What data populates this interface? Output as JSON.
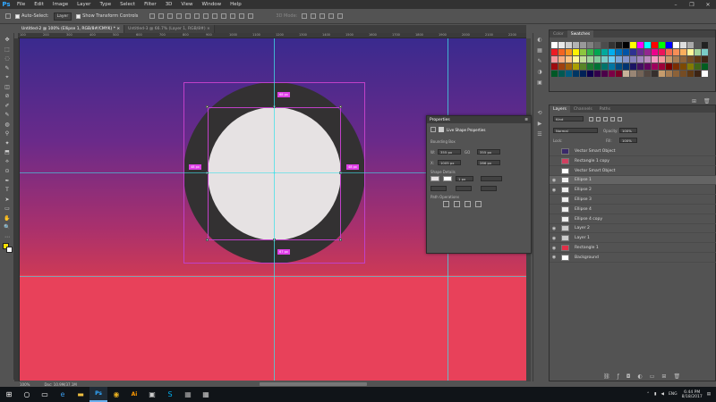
{
  "app": {
    "logo": "Ps"
  },
  "menu": [
    "File",
    "Edit",
    "Image",
    "Layer",
    "Type",
    "Select",
    "Filter",
    "3D",
    "View",
    "Window",
    "Help"
  ],
  "window_controls": {
    "minimize": "–",
    "restore": "❐",
    "close": "✕"
  },
  "options": {
    "auto_select_label": "Auto-Select:",
    "auto_select_value": "Layer",
    "transform_label": "Show Transform Controls",
    "mode_3d": "3D Mode:"
  },
  "tabs": [
    {
      "label": "Untitled-2 @ 100% (Ellipse 1, RGB/8#/CMYK) *  ×"
    },
    {
      "label": "Untitled-3 @ 66.7% (Layer 1, RGB/8#) ×"
    }
  ],
  "ruler": {
    "h": [
      "100",
      "200",
      "300",
      "400",
      "500",
      "600",
      "700",
      "800",
      "900",
      "1000",
      "1100",
      "1200",
      "1300",
      "1400",
      "1500",
      "1600",
      "1700",
      "1800",
      "1900",
      "2000",
      "2100",
      "2200"
    ]
  },
  "tools": [
    "✥",
    "⬚",
    "◌",
    "✎",
    "⌖",
    "◫",
    "⊘",
    "✐",
    "✎",
    "◍",
    "⚲",
    "✦",
    "⬒",
    "⟡",
    "⊙",
    "✒",
    "T",
    "➤",
    "▭",
    "✋",
    "🔍",
    "⋯"
  ],
  "measure": {
    "top": "68 px",
    "left": "48 px",
    "right": "48 px",
    "bottom": "67 px"
  },
  "status": {
    "zoom": "100%",
    "doc": "Doc: 10.9M/37.1M"
  },
  "swatches_panel": {
    "tabs": [
      "Color",
      "Swatches"
    ],
    "colors": [
      "#ffffff",
      "#e9e9e9",
      "#cfcfcf",
      "#b3b3b3",
      "#999999",
      "#808080",
      "#666666",
      "#4c4c4c",
      "#333333",
      "#1a1a1a",
      "#000000",
      "#ffff00",
      "#ff00ff",
      "#00ffff",
      "#ff0000",
      "#00ff00",
      "#0000ff",
      "#ffffff",
      "#dddddd",
      "#aaaaaa",
      "#555555",
      "#222222",
      "#ed1c24",
      "#f26522",
      "#f7941d",
      "#fff200",
      "#8dc63f",
      "#39b54a",
      "#00a651",
      "#00a99d",
      "#00aeef",
      "#0072bc",
      "#0054a6",
      "#2e3192",
      "#662d91",
      "#92278f",
      "#ec008c",
      "#ed145b",
      "#f26c4f",
      "#f68e56",
      "#fbaf5d",
      "#fff799",
      "#a3d39c",
      "#7accc8",
      "#f5989d",
      "#f9ad81",
      "#fdc68a",
      "#fff799",
      "#c4df9b",
      "#a3d39c",
      "#82ca9c",
      "#7accc8",
      "#6dcff6",
      "#7da7d9",
      "#8393ca",
      "#8781bd",
      "#a187be",
      "#bc8dbf",
      "#f49ac2",
      "#f6989d",
      "#c69c6d",
      "#a67c52",
      "#8c6239",
      "#754c24",
      "#603913",
      "#3c2415",
      "#9e0b0f",
      "#a0410d",
      "#a36209",
      "#aba000",
      "#598527",
      "#1a7b30",
      "#007236",
      "#00746b",
      "#0076a3",
      "#004b80",
      "#003471",
      "#1b1464",
      "#440e62",
      "#630460",
      "#9e005d",
      "#9e0039",
      "#790000",
      "#7b2e00",
      "#7d4900",
      "#827b00",
      "#406618",
      "#005e20",
      "#005826",
      "#005952",
      "#005b7f",
      "#003663",
      "#002157",
      "#0d004c",
      "#32004b",
      "#4b0049",
      "#7b0046",
      "#7a0026",
      "#c7b299",
      "#998675",
      "#736357",
      "#534741",
      "#362f2d",
      "#c69c6d",
      "#a67c52",
      "#8c6239",
      "#754c24",
      "#603913",
      "#3c2415",
      "#ffffff"
    ]
  },
  "layers_panel": {
    "tabs": [
      "Layers",
      "Channels",
      "Paths"
    ],
    "kind": "Kind",
    "blend": "Normal",
    "opacity_label": "Opacity:",
    "opacity": "100%",
    "lock_label": "Lock:",
    "fill_label": "Fill:",
    "fill": "100%",
    "layers": [
      {
        "name": "Vector Smart Object",
        "eye": "",
        "thumb": "#3a2a6a"
      },
      {
        "name": "Rectangle 1 copy",
        "eye": "",
        "thumb": "#d04060"
      },
      {
        "name": "Vector Smart Object",
        "eye": "",
        "thumb": "#ffffff"
      },
      {
        "name": "Ellipse 1",
        "eye": "◉",
        "thumb": "#f0f0f0",
        "selected": true
      },
      {
        "name": "Ellipse 2",
        "eye": "◉",
        "thumb": "#eeeeee"
      },
      {
        "name": "Ellipse 3",
        "eye": "",
        "thumb": "#eeeeee"
      },
      {
        "name": "Ellipse 4",
        "eye": "",
        "thumb": "#eeeeee"
      },
      {
        "name": "Ellipse 4 copy",
        "eye": "",
        "thumb": "#eeeeee"
      },
      {
        "name": "Layer 2",
        "eye": "◉",
        "thumb": "#cccccc"
      },
      {
        "name": "Layer 1",
        "eye": "◉",
        "thumb": "#cccccc"
      },
      {
        "name": "Rectangle 1",
        "eye": "◉",
        "thumb": "#e03048"
      },
      {
        "name": "Background",
        "eye": "◉",
        "thumb": "#ffffff"
      }
    ]
  },
  "properties": {
    "title": "Properties",
    "subtitle": "Live Shape Properties",
    "bounding": "Bounding Box",
    "w_label": "W:",
    "w": "355 px",
    "go_label": "GO",
    "h": "355 px",
    "x_label": "X:",
    "x": "1005 px",
    "y_label": "Y:",
    "y": "286 px",
    "shape_details": "Shape Details",
    "stroke": "1 px",
    "path_ops": "Path Operations"
  },
  "taskbar": {
    "time": "6:44 PM",
    "date": "8/18/2017",
    "lang": "ENG"
  }
}
